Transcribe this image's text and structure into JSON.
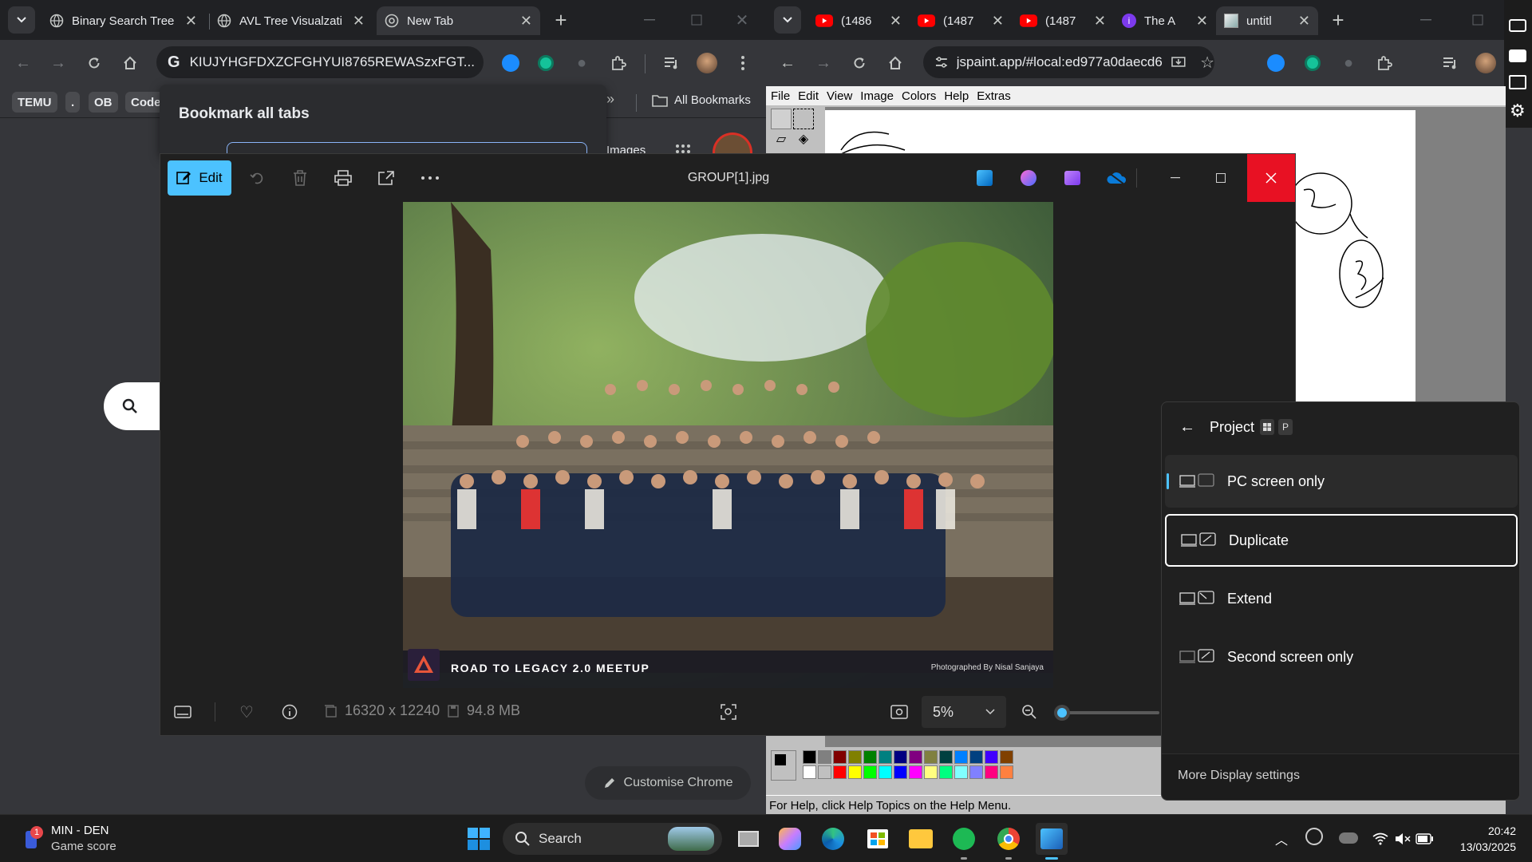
{
  "left_browser": {
    "tabs": [
      {
        "title": "Binary Search Tree"
      },
      {
        "title": "AVL Tree Visualzati"
      },
      {
        "title": "New Tab"
      }
    ],
    "address": "KIUJYHGFDXZCFGHYUI8765REWASzxFGT...",
    "bookmarks": [
      "TEMU",
      ".",
      "OB",
      "Code"
    ],
    "all_bookmarks": "All Bookmarks",
    "images_link": "Images",
    "bookmark_popup_title": "Bookmark all tabs",
    "customise_chrome": "Customise Chrome"
  },
  "right_browser": {
    "tabs": [
      {
        "title": "(1486"
      },
      {
        "title": "(1487"
      },
      {
        "title": "(1487"
      },
      {
        "title": "The A"
      },
      {
        "title": "untitl"
      }
    ],
    "address": "jspaint.app/#local:ed977a0daecd6"
  },
  "jspaint": {
    "menu": [
      "File",
      "Edit",
      "View",
      "Image",
      "Colors",
      "Help",
      "Extras"
    ],
    "status": "For Help, click Help Topics on the Help Menu.",
    "palette_row1": [
      "#000000",
      "#808080",
      "#800000",
      "#808000",
      "#008000",
      "#008080",
      "#000080",
      "#800080",
      "#808040",
      "#004040",
      "#0080ff",
      "#004080",
      "#4000ff",
      "#804000"
    ],
    "palette_row2": [
      "#ffffff",
      "#c0c0c0",
      "#ff0000",
      "#ffff00",
      "#00ff00",
      "#00ffff",
      "#0000ff",
      "#ff00ff",
      "#ffff80",
      "#00ff80",
      "#80ffff",
      "#8080ff",
      "#ff0080",
      "#ff8040"
    ]
  },
  "photos": {
    "edit_label": "Edit",
    "filename": "GROUP[1].jpg",
    "dimensions": "16320 x 12240",
    "filesize": "94.8 MB",
    "zoom": "5%",
    "zoom_fraction": 0.05,
    "banner_text": "ROAD TO LEGACY 2.0 MEETUP",
    "credit": "Photographed By Nisal Sanjaya",
    "logo_text": "ROAD TO LEGACY"
  },
  "project": {
    "title": "Project",
    "shortcut_key": "P",
    "options": [
      "PC screen only",
      "Duplicate",
      "Extend",
      "Second screen only"
    ],
    "active_option": "PC screen only",
    "focused_option": "Duplicate",
    "more": "More Display settings"
  },
  "taskbar": {
    "widget_title": "MIN - DEN",
    "widget_sub": "Game score",
    "widget_badge": "1",
    "search": "Search",
    "time": "20:42",
    "date": "13/03/2025"
  },
  "colors": {
    "accent": "#4cc2ff",
    "close_red": "#e81123",
    "youtube": "#ff0000"
  }
}
